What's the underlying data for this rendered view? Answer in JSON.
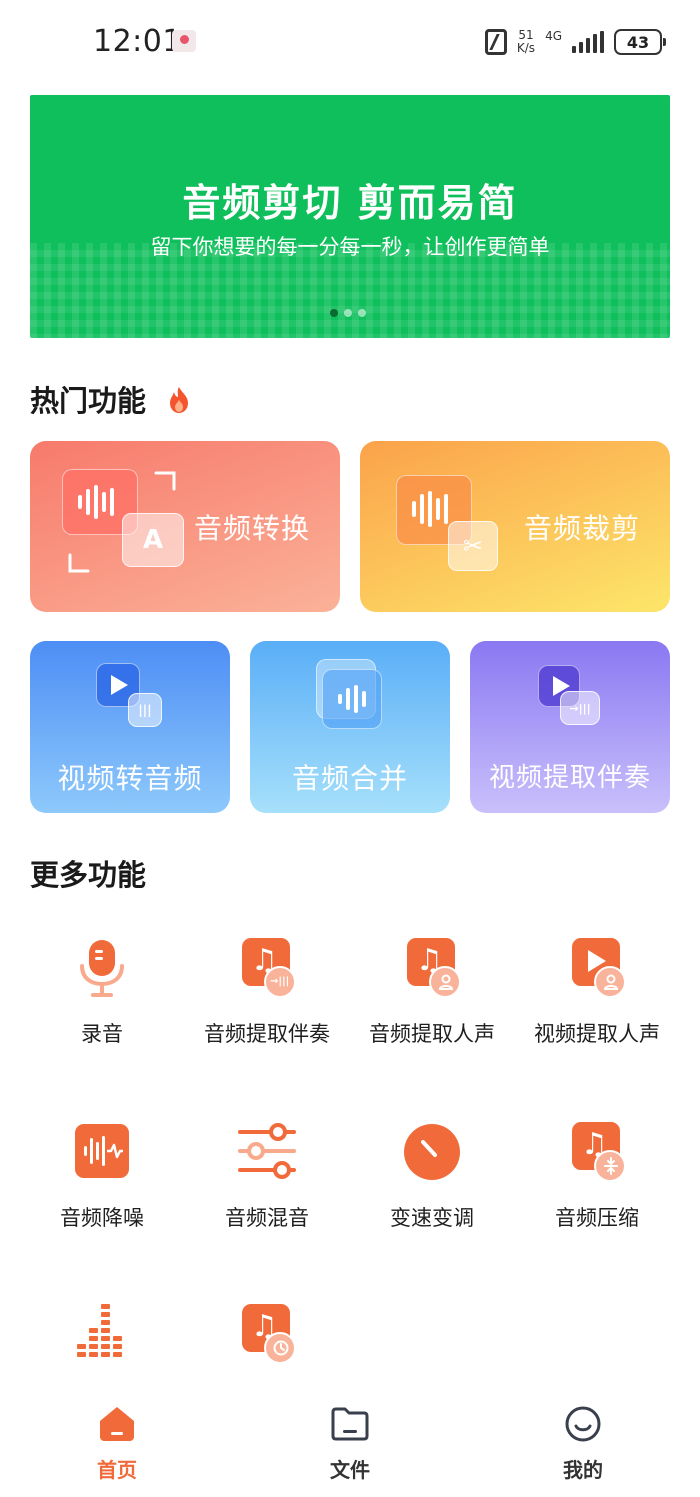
{
  "status_bar": {
    "time": "12:01",
    "net_speed_value": "51",
    "net_speed_unit": "K/s",
    "net_type": "4G",
    "battery": "43",
    "icons": [
      "notification-icon",
      "nfc-icon",
      "signal-icon",
      "battery-icon"
    ]
  },
  "banner": {
    "title": "音频剪切 剪而易简",
    "subtitle": "留下你想要的每一分每一秒，让创作更简单",
    "page_count": 3,
    "active_page": 1,
    "color": "#0fbf5c"
  },
  "hot": {
    "title": "热门功能",
    "title_icon": "fire-icon",
    "cards": [
      {
        "label": "音频转换",
        "icon": "audio-convert-icon"
      },
      {
        "label": "音频裁剪",
        "icon": "audio-cut-icon"
      },
      {
        "label": "视频转音频",
        "icon": "video-to-audio-icon"
      },
      {
        "label": "音频合并",
        "icon": "audio-merge-icon"
      },
      {
        "label": "视频提取伴奏",
        "icon": "video-extract-accompaniment-icon"
      }
    ]
  },
  "more": {
    "title": "更多功能",
    "accent": "#f06a3a",
    "items": [
      {
        "label": "录音",
        "icon": "microphone-icon"
      },
      {
        "label": "音频提取伴奏",
        "icon": "music-extract-accompaniment-icon"
      },
      {
        "label": "音频提取人声",
        "icon": "music-extract-voice-icon"
      },
      {
        "label": "视频提取人声",
        "icon": "video-extract-voice-icon"
      },
      {
        "label": "音频降噪",
        "icon": "noise-reduction-icon"
      },
      {
        "label": "音频混音",
        "icon": "mixer-sliders-icon"
      },
      {
        "label": "变速变调",
        "icon": "speed-dial-icon"
      },
      {
        "label": "音频压缩",
        "icon": "music-compress-icon"
      },
      {
        "label": "",
        "icon": "equalizer-icon"
      },
      {
        "label": "",
        "icon": "music-timer-icon"
      }
    ]
  },
  "nav": {
    "items": [
      {
        "label": "首页",
        "icon": "home-icon",
        "active": true
      },
      {
        "label": "文件",
        "icon": "folder-icon",
        "active": false
      },
      {
        "label": "我的",
        "icon": "smile-icon",
        "active": false
      }
    ],
    "active_color": "#f06a3a"
  }
}
